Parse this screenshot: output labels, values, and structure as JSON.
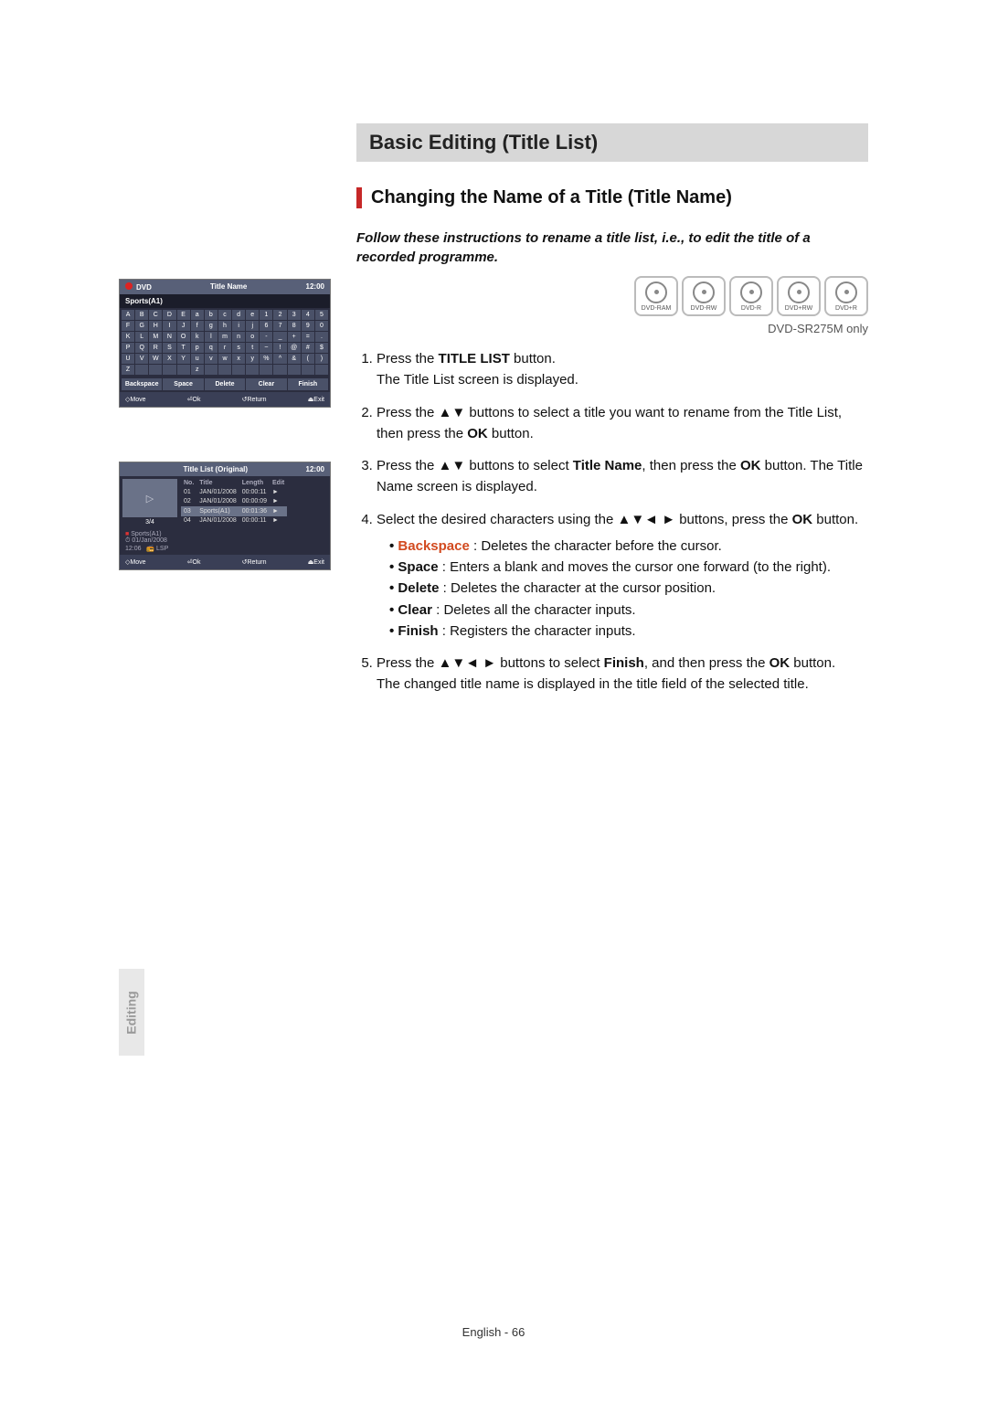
{
  "sideTab": "Editing",
  "footer": "English - 66",
  "sectionTitle": "Basic Editing (Title List)",
  "subhead": "Changing the Name of a Title (Title Name)",
  "intro": "Follow these instructions to rename a title list, i.e., to edit the title of a recorded programme.",
  "discs": [
    "DVD-RAM",
    "DVD-RW",
    "DVD-R",
    "DVD+RW",
    "DVD+R"
  ],
  "modelNote": "DVD-SR275M only",
  "steps": {
    "s1a": "Press the ",
    "s1b": "TITLE LIST",
    "s1c": " button.",
    "s1d": "The Title List screen is displayed.",
    "s2a": "Press the ▲▼ buttons to select a title you want to rename from the Title List, then press the ",
    "s2b": "OK",
    "s2c": " button.",
    "s3a": "Press the  ▲▼ buttons to select ",
    "s3b": "Title Name",
    "s3c": ", then press the ",
    "s3d": "OK",
    "s3e": " button.  The Title Name screen is displayed.",
    "s4a": "Select the desired characters using the ▲▼◄ ► buttons, press the ",
    "s4b": "OK",
    "s4c": " button.",
    "bullets": {
      "backspace_k": "Backspace",
      "backspace_v": " : Deletes the character before the cursor.",
      "space_k": "Space",
      "space_v": " : Enters a blank and moves the cursor one forward (to the right).",
      "delete_k": "Delete",
      "delete_v": " : Deletes the character at the cursor position.",
      "clear_k": "Clear",
      "clear_v": " : Deletes all the character inputs.",
      "finish_k": "Finish",
      "finish_v": " : Registers the character inputs."
    },
    "s5a": "Press the ▲▼◄ ► buttons to select ",
    "s5b": "Finish",
    "s5c": ", and then press the ",
    "s5d": "OK",
    "s5e": " button.",
    "s5f": "The changed title name is displayed in the title field of the selected title."
  },
  "osd1": {
    "header_left": "DVD",
    "header_mid": "Title Name",
    "header_right": "12:00",
    "field_value": "Sports(A1)",
    "grid": [
      "A",
      "B",
      "C",
      "D",
      "E",
      "a",
      "b",
      "c",
      "d",
      "e",
      "1",
      "2",
      "3",
      "4",
      "5",
      "F",
      "G",
      "H",
      "I",
      "J",
      "f",
      "g",
      "h",
      "i",
      "j",
      "6",
      "7",
      "8",
      "9",
      "0",
      "K",
      "L",
      "M",
      "N",
      "O",
      "k",
      "l",
      "m",
      "n",
      "o",
      "-",
      "_",
      "+",
      "=",
      ".",
      "P",
      "Q",
      "R",
      "S",
      "T",
      "p",
      "q",
      "r",
      "s",
      "t",
      "~",
      "!",
      "@",
      "#",
      "$",
      "U",
      "V",
      "W",
      "X",
      "Y",
      "u",
      "v",
      "w",
      "x",
      "y",
      "%",
      "^",
      "&",
      "(",
      ")",
      "Z",
      " ",
      " ",
      " ",
      " ",
      "z",
      " ",
      " ",
      " ",
      " ",
      " ",
      " ",
      " ",
      " ",
      " "
    ],
    "buttons": [
      "Backspace",
      "Space",
      "Delete",
      "Clear",
      "Finish"
    ],
    "footer": [
      "◇Move",
      "⏎Ok",
      "↺Return",
      "⏏Exit"
    ]
  },
  "osd2": {
    "header_mid": "Title List (Original)",
    "header_right": "12:00",
    "counter": "3/4",
    "cols": [
      "No.",
      "Title",
      "Length",
      "Edit"
    ],
    "rows": [
      {
        "no": "01",
        "title": "JAN/01/2008",
        "len": "00:00:11",
        "edit": "►"
      },
      {
        "no": "02",
        "title": "JAN/01/2008",
        "len": "00:00:09",
        "edit": "►"
      },
      {
        "no": "03",
        "title": "Sports(A1)",
        "len": "00:01:36",
        "edit": "►"
      },
      {
        "no": "04",
        "title": "JAN/01/2008",
        "len": "00:00:11",
        "edit": "►"
      }
    ],
    "selected": 2,
    "meta_title": "Sports(A1)",
    "meta_date": "01/Jan/2008",
    "meta_time": "12:06",
    "meta_mode": "LSP",
    "footer": [
      "◇Move",
      "⏎Ok",
      "↺Return",
      "⏏Exit"
    ]
  }
}
